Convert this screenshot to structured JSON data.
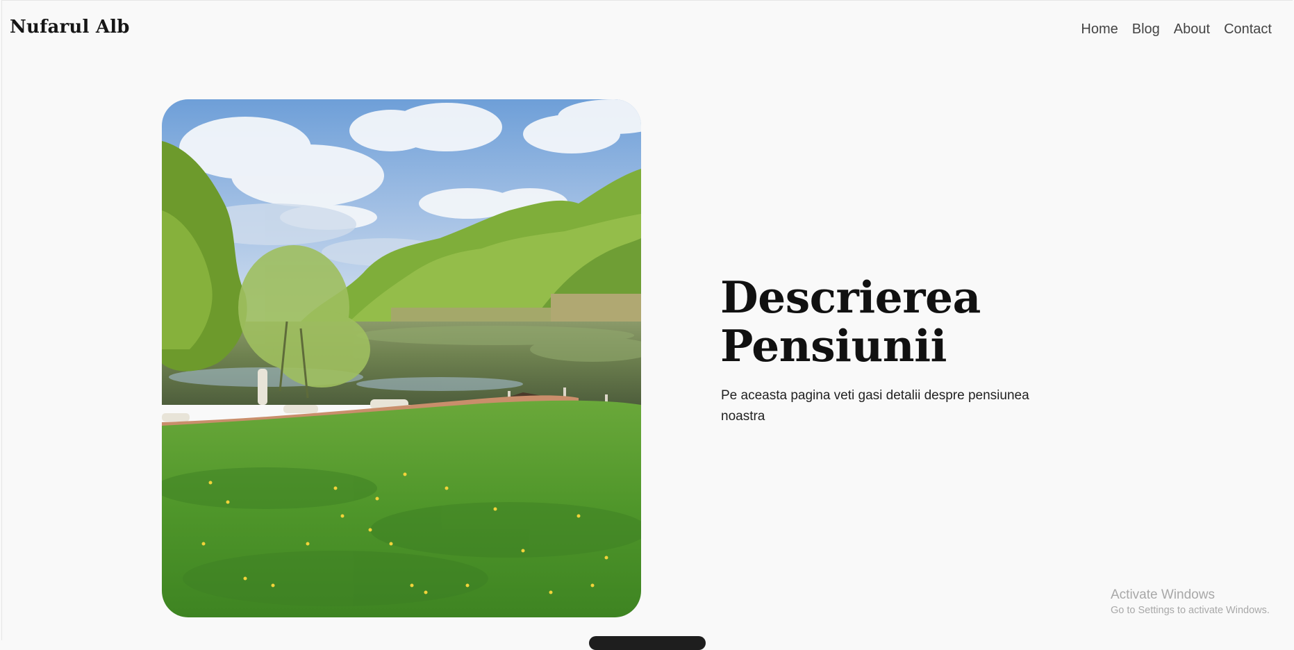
{
  "header": {
    "logo": "Nufarul Alb",
    "nav": [
      "Home",
      "Blog",
      "About",
      "Contact"
    ]
  },
  "hero": {
    "image_alt": "lake-landscape-photo",
    "title_line1": "Descrierea",
    "title_line2": "Pensiunii",
    "subtitle": "Pe aceasta pagina veti gasi detalii despre pensiunea noastra"
  },
  "watermark": {
    "title": "Activate Windows",
    "subtitle": "Go to Settings to activate Windows."
  },
  "colors": {
    "background": "#f9f9f9",
    "text": "#111111",
    "nav_text": "#444444",
    "watermark": "#a8a8a8"
  }
}
